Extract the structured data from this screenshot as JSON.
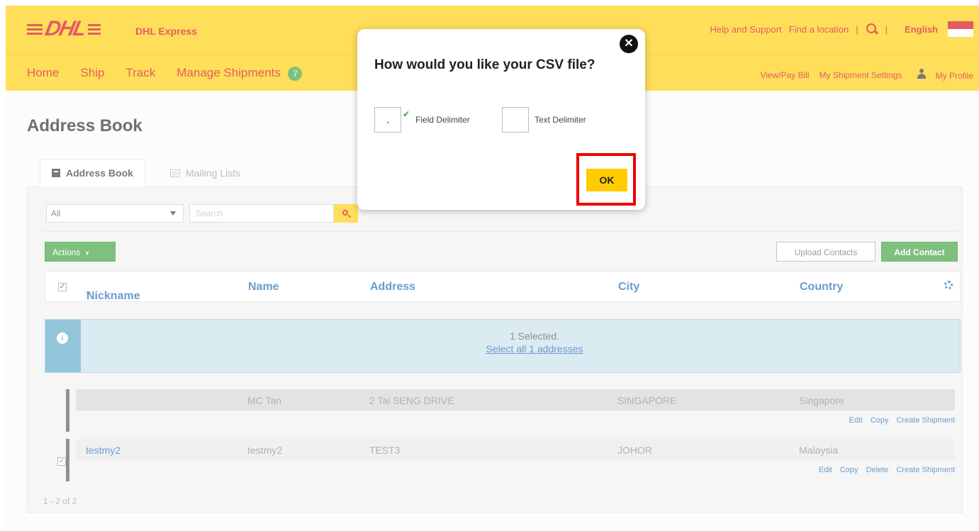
{
  "brand": {
    "name": "DHL Express"
  },
  "topbar": {
    "help": "Help and Support",
    "find": "Find a location",
    "separator": "|",
    "language": "English"
  },
  "nav": {
    "home": "Home",
    "ship": "Ship",
    "track": "Track",
    "manage": "Manage Shipments",
    "manage_badge": "7",
    "view_bill": "View/Pay Bill",
    "settings": "My Shipment Settings",
    "profile": "My Profile"
  },
  "page": {
    "title": "Address Book",
    "tabs": [
      {
        "label": "Address Book"
      },
      {
        "label": "Mailing Lists"
      }
    ],
    "filter": {
      "value": "All",
      "search_placeholder": "Search"
    },
    "actions_label": "Actions",
    "upload_label": "Upload Contacts",
    "add_label": "Add Contact",
    "columns": {
      "nickname": "Nickname",
      "name": "Name",
      "address": "Address",
      "city": "City",
      "country": "Country"
    },
    "info": {
      "selected": "1 Selected.",
      "select_all": "Select all 1 addresses"
    },
    "rows": [
      {
        "nickname": "",
        "name": "MC Tan",
        "address": "2 Tai SENG DRIVE",
        "city": "SINGAPORE",
        "country": "Singapore",
        "actions": [
          "Edit",
          "Copy",
          "Create Shipment"
        ]
      },
      {
        "nickname": "testmy2",
        "name": "testmy2",
        "address": "TEST3",
        "city": "JOHOR",
        "country": "Malaysia",
        "actions": [
          "Edit",
          "Copy",
          "Delete",
          "Create Shipment"
        ]
      }
    ],
    "pager": "1 - 2 of 2"
  },
  "modal": {
    "title": "How would you like your CSV file?",
    "field_delimiter_value": ",",
    "field_delimiter_label": "Field Delimiter",
    "text_delimiter_value": "",
    "text_delimiter_label": "Text Delimiter",
    "ok_label": "OK",
    "close_glyph": "✕"
  },
  "colors": {
    "brand_yellow": "#ffcc00",
    "brand_red": "#d40511",
    "action_green": "#3aa03a",
    "highlight_red": "#ee0000"
  }
}
